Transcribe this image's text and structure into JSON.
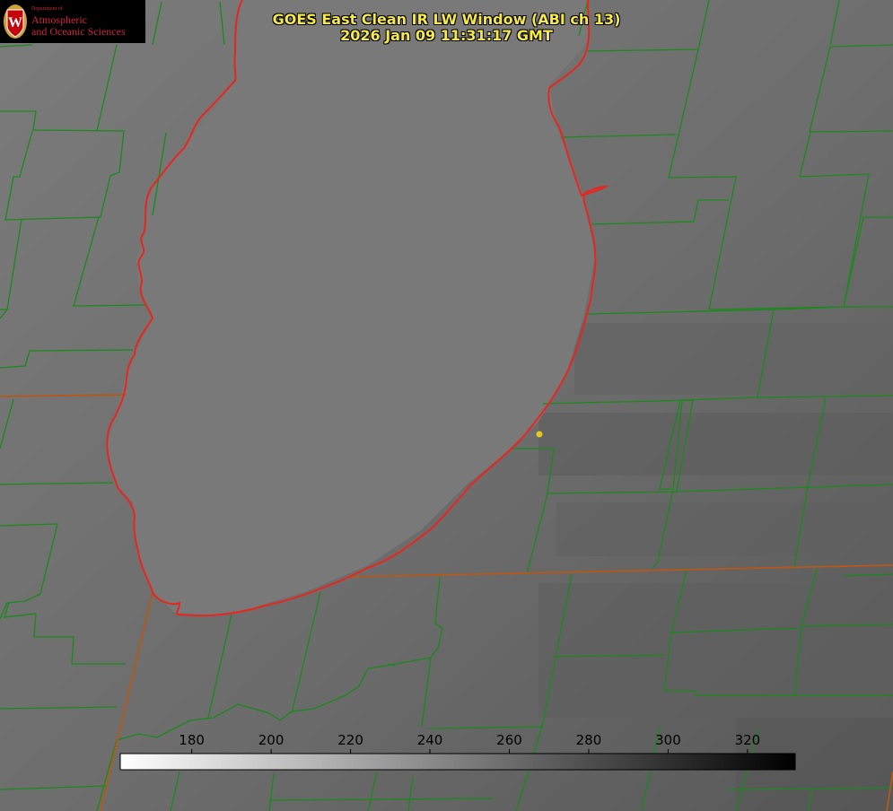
{
  "title": {
    "line1": "GOES East Clean IR LW Window (ABI ch 13)",
    "line2": "2026 Jan 09 11:31:17 GMT"
  },
  "logo": {
    "dept": "Department of",
    "line1": "Atmospheric",
    "line2": "and Oceanic Sciences",
    "shield_letter": "W"
  },
  "colorbar": {
    "ticks": [
      "180",
      "200",
      "220",
      "240",
      "260",
      "280",
      "300",
      "320"
    ],
    "tick_values": [
      180,
      200,
      220,
      240,
      260,
      280,
      300,
      320
    ],
    "range": [
      162,
      332
    ],
    "palette": "greyscale inverted: white (cold) to black (warm)"
  },
  "colors": {
    "title": "#f5e84a",
    "county_borders": "#1a8a1a",
    "coastline": "#e8261e",
    "state_borders": "#b5581a",
    "marker": "#e6c91a",
    "logo_text": "#d3203f"
  }
}
